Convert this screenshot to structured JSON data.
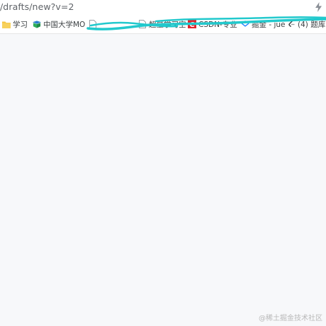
{
  "address_bar": {
    "url_text": "/drafts/new?v=2"
  },
  "bookmarks": [
    {
      "label": "学习",
      "icon": "folder-icon"
    },
    {
      "label": "中国大学MO",
      "icon": "mooc-logo-icon"
    },
    {
      "label": "",
      "icon": "page-icon"
    },
    {
      "label": "超星学习空",
      "icon": "page-icon"
    },
    {
      "label": "CSDN-专业",
      "icon": "csdn-logo-icon"
    },
    {
      "label": "掘金 - jue",
      "icon": "juejin-logo-icon"
    },
    {
      "label": "(4) 题库",
      "icon": "leetcode-logo-icon"
    }
  ],
  "watermark": {
    "text": "@稀土掘金技术社区"
  },
  "colors": {
    "page_background": "#f7f8fa",
    "scribble": "#22c9cd",
    "folder": "#f4c542",
    "csdn_red": "#e3242b",
    "juejin_blue": "#1e80ff"
  }
}
